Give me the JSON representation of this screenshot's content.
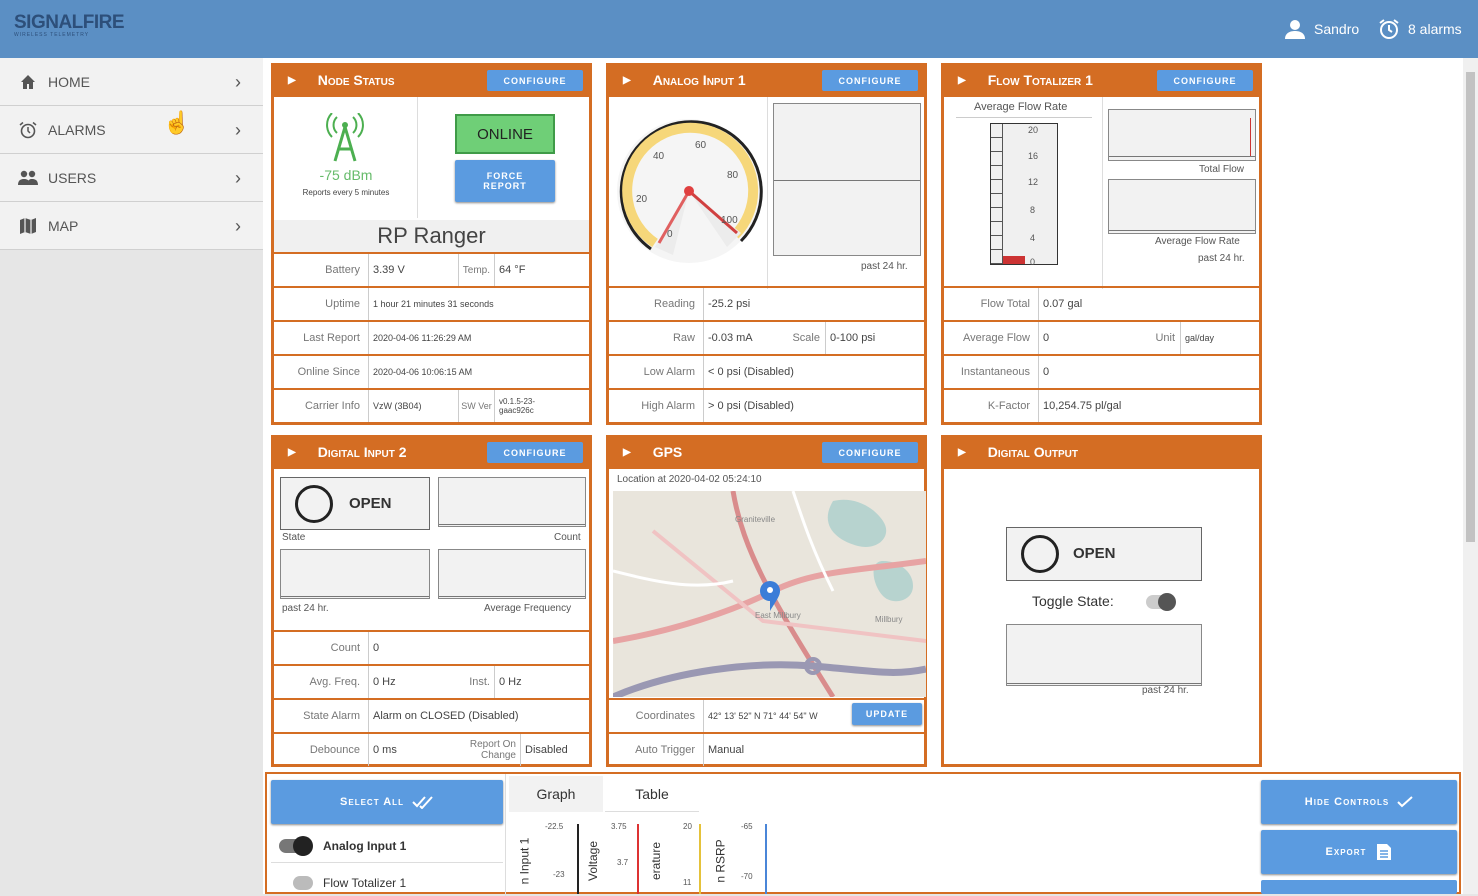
{
  "app": {
    "logo": "SIGNALFIRE",
    "logo_sub": "WIRELESS TELEMETRY",
    "user": "Sandro",
    "alarms": "8 alarms"
  },
  "nav": [
    {
      "label": "HOME",
      "icon": "home-icon"
    },
    {
      "label": "ALARMS",
      "icon": "alarm-clock-icon"
    },
    {
      "label": "USERS",
      "icon": "users-icon"
    },
    {
      "label": "MAP",
      "icon": "map-icon"
    }
  ],
  "configure": "CONFIGURE",
  "node": {
    "title": "Node Status",
    "signal": "-75 dBm",
    "reports": "Reports every 5 minutes",
    "online": "ONLINE",
    "force": "FORCE REPORT",
    "name": "RP Ranger",
    "battery_l": "Battery",
    "battery": "3.39 V",
    "temp_l": "Temp.",
    "temp": "64 °F",
    "uptime_l": "Uptime",
    "uptime": "1 hour 21 minutes 31 seconds",
    "last_l": "Last Report",
    "last": "2020-04-06 11:26:29 AM",
    "online_l": "Online Since",
    "online_since": "2020-04-06 10:06:15 AM",
    "carrier_l": "Carrier Info",
    "carrier": "VzW (3B04)",
    "sw_l": "SW Ver",
    "sw": "v0.1.5-23-gaac926c"
  },
  "analog": {
    "title": "Analog Input 1",
    "g40": "40",
    "g60": "60",
    "g80": "80",
    "g20": "20",
    "g0": "0",
    "g100": "100",
    "past": "past 24 hr.",
    "reading_l": "Reading",
    "reading": "-25.2 psi",
    "raw_l": "Raw",
    "raw": "-0.03 mA",
    "scale_l": "Scale",
    "scale": "0-100 psi",
    "low_l": "Low Alarm",
    "low": "< 0 psi (Disabled)",
    "high_l": "High Alarm",
    "high": "> 0 psi (Disabled)"
  },
  "flow": {
    "title": "Flow Totalizer 1",
    "avg_rate": "Average Flow Rate",
    "t20": "20",
    "t16": "16",
    "t12": "12",
    "t8": "8",
    "t4": "4",
    "t0": "0",
    "total_flow": "Total Flow",
    "avg_rate2": "Average Flow Rate",
    "past": "past 24 hr.",
    "ft_l": "Flow Total",
    "ft": "0.07 gal",
    "af_l": "Average Flow",
    "af": "0",
    "unit_l": "Unit",
    "unit": "gal/day",
    "inst_l": "Instantaneous",
    "inst": "0",
    "k_l": "K-Factor",
    "k": "10,254.75 pl/gal"
  },
  "digital_in": {
    "title": "Digital Input 2",
    "open": "OPEN",
    "state": "State",
    "count_lbl": "Count",
    "past": "past 24 hr.",
    "avgfreq_lbl": "Average Frequency",
    "count_l": "Count",
    "count": "0",
    "avg_l": "Avg. Freq.",
    "avg": "0 Hz",
    "inst_l": "Inst.",
    "inst": "0 Hz",
    "sa_l": "State Alarm",
    "sa": "Alarm on CLOSED (Disabled)",
    "deb_l": "Debounce",
    "deb": "0 ms",
    "roc_l": "Report On Change",
    "roc": "Disabled"
  },
  "gps": {
    "title": "GPS",
    "loc": "Location at 2020-04-02 05:24:10",
    "map1": "Graniteville",
    "map2": "East Millbury",
    "map3": "Millbury",
    "coord_l": "Coordinates",
    "coord": "42° 13' 52\" N 71° 44' 54\" W",
    "update": "UPDATE",
    "auto_l": "Auto Trigger",
    "auto": "Manual"
  },
  "digital_out": {
    "title": "Digital Output",
    "open": "OPEN",
    "toggle": "Toggle State:",
    "past": "past 24 hr."
  },
  "bottom": {
    "select_all": "Select All",
    "graph_tab": "Graph",
    "table_tab": "Table",
    "ch1": "Analog Input 1",
    "ch2": "Flow Totalizer 1",
    "hide": "Hide Controls",
    "export": "Export",
    "ax1": "n Input 1",
    "ax2": "Voltage",
    "ax3": "erature",
    "ax4": "n RSRP",
    "a1t": "-22.5",
    "a1b": "-23",
    "a2t": "3.75",
    "a2b": "3.7",
    "a3t": "20",
    "a3b": "11",
    "a4t": "-65",
    "a4b": "-70"
  }
}
